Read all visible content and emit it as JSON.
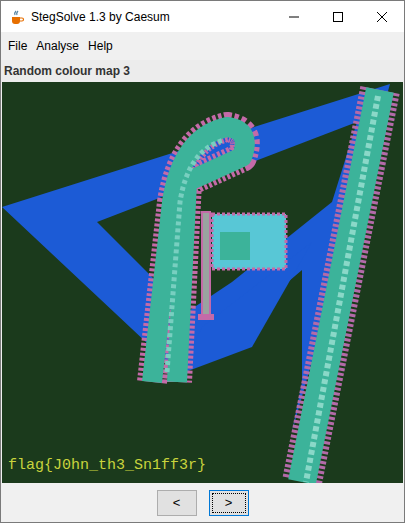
{
  "window": {
    "title": "StegSolve 1.3 by Caesum"
  },
  "menu": [
    "File",
    "Analyse",
    "Help"
  ],
  "view": {
    "label": "Random colour map 3",
    "caption": "flag{J0hn_th3_Sn1ff3r}"
  },
  "buttons": [
    {
      "label": "<",
      "focused": false
    },
    {
      "label": ">",
      "focused": true
    }
  ]
}
